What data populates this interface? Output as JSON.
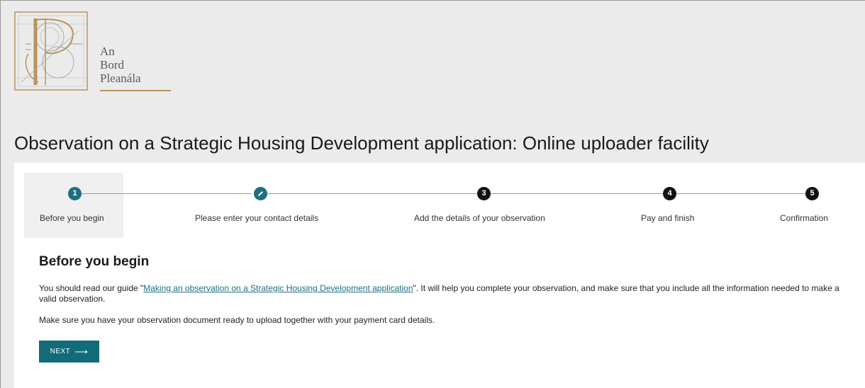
{
  "header": {
    "logo_lines": [
      "An",
      "Bord",
      "Pleanála"
    ],
    "title": "Observation on a Strategic Housing Development application: Online uploader facility"
  },
  "stepper": {
    "steps": [
      {
        "number": "1",
        "label": "Before you begin",
        "state": "active"
      },
      {
        "number": "",
        "label": "Please enter your contact details",
        "state": "edit"
      },
      {
        "number": "3",
        "label": "Add the details of your observation",
        "state": "pending"
      },
      {
        "number": "4",
        "label": "Pay and finish",
        "state": "pending"
      },
      {
        "number": "5",
        "label": "Confirmation",
        "state": "pending"
      }
    ]
  },
  "content": {
    "heading": "Before you begin",
    "para1_before": "You should read our guide \"",
    "para1_link": "Making an observation on a Strategic Housing Development application",
    "para1_after": "\". It will help you complete your observation, and make sure that you include all the information needed to make a valid observation.",
    "para2": "Make sure you have your observation document ready to upload together with your payment card details.",
    "next_label": "NEXT",
    "next_icon": "arrow-right-icon"
  },
  "colors": {
    "accent": "#1d6f80",
    "button": "#126b79",
    "logo_gold": "#b7945a",
    "background": "#ebebeb"
  }
}
